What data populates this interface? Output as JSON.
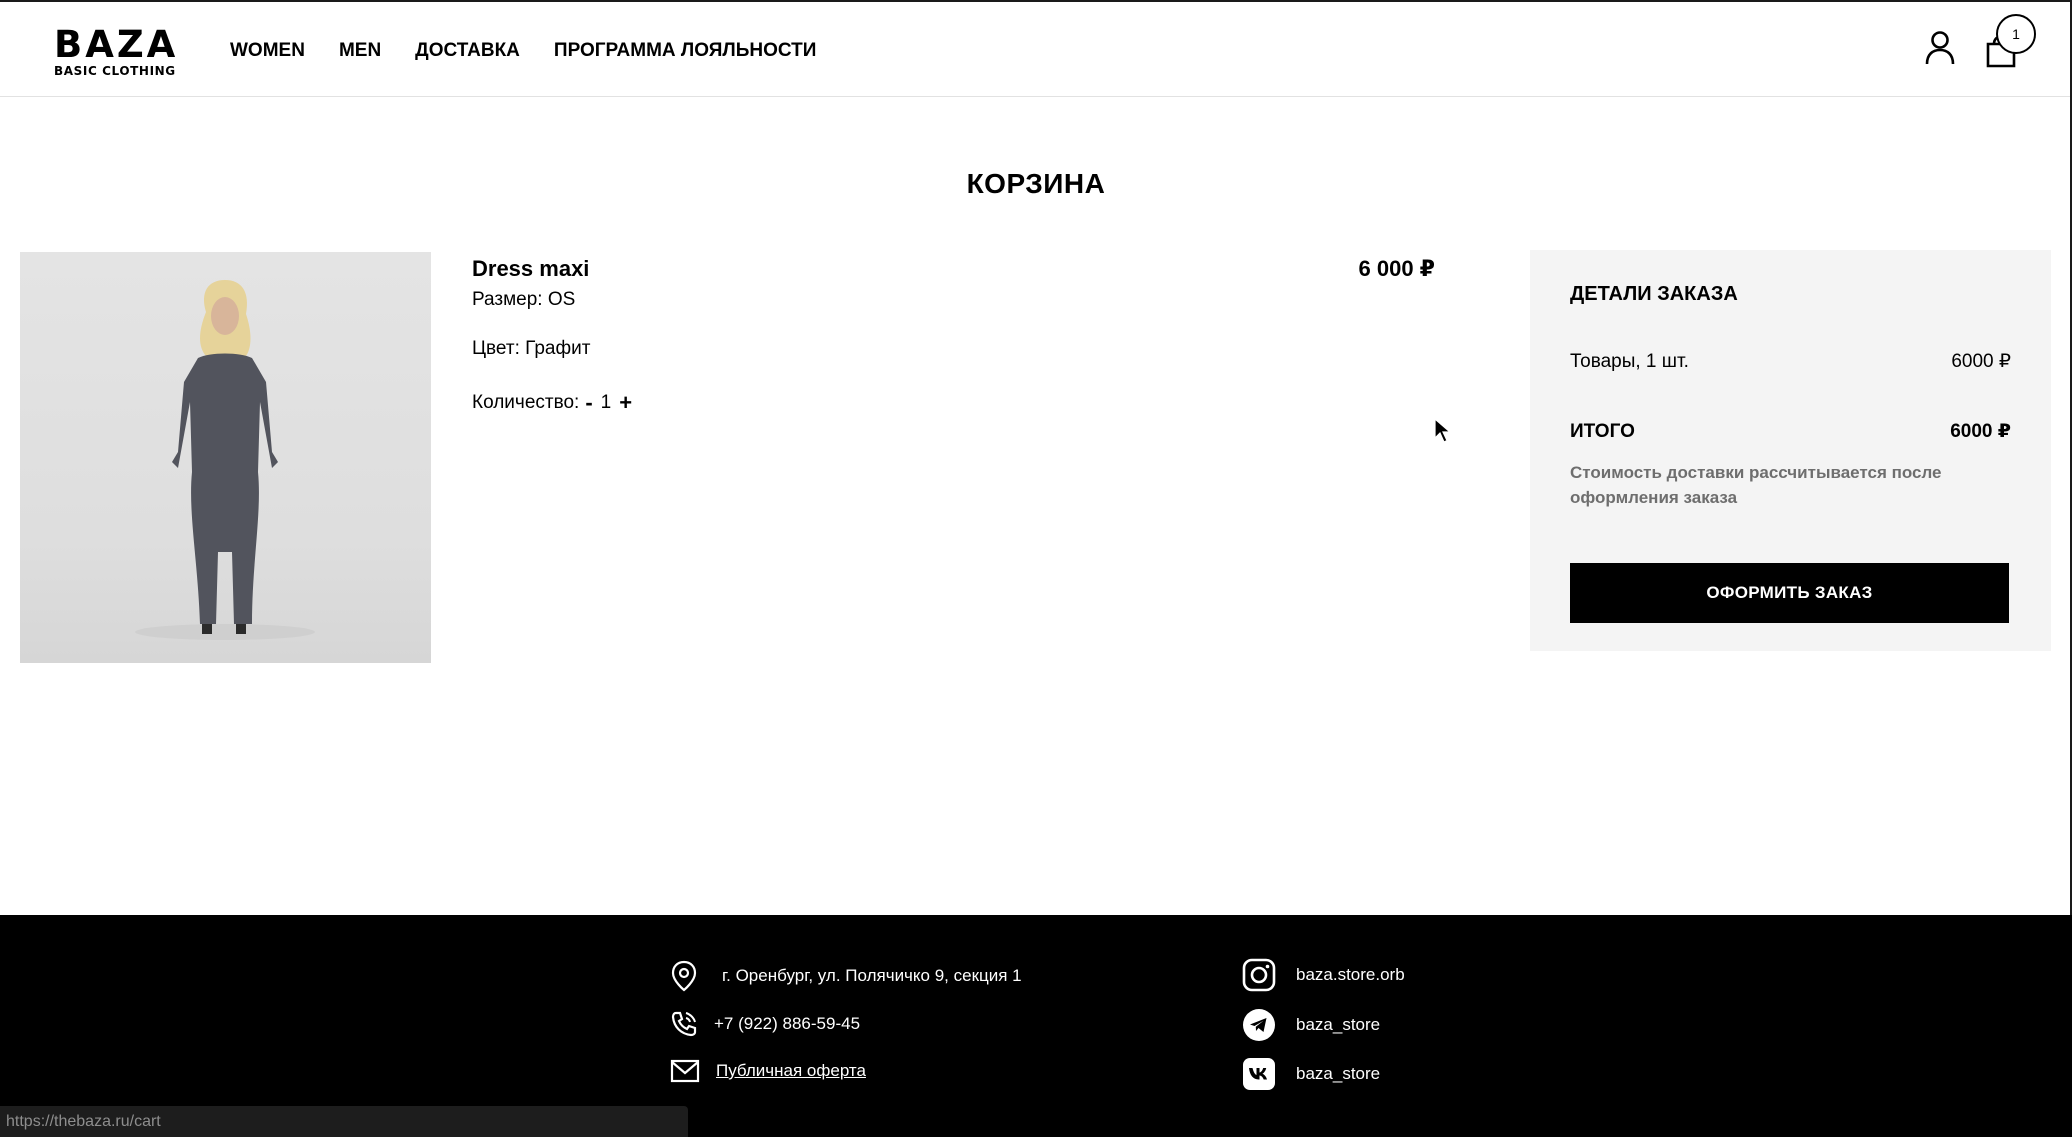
{
  "brand": {
    "name": "BAZA",
    "tagline": "BASIC CLOTHING"
  },
  "nav": {
    "items": [
      {
        "label": "WOMEN"
      },
      {
        "label": "MEN"
      },
      {
        "label": "ДОСТАВКА"
      },
      {
        "label": "ПРОГРАММА ЛОЯЛЬНОСТИ"
      }
    ]
  },
  "header": {
    "cart_count": "1"
  },
  "page": {
    "title": "КОРЗИНА"
  },
  "cart_item": {
    "name": "Dress maxi",
    "price": "6 000 ₽",
    "size": "Размер: OS",
    "color": "Цвет: Графит",
    "quantity_label": "Количество:",
    "decrement": "-",
    "quantity": "1",
    "increment": "+"
  },
  "summary": {
    "title": "ДЕТАЛИ ЗАКАЗА",
    "goods_label": "Товары, 1 шт.",
    "goods_value": "6000 ₽",
    "total_label": "ИТОГО",
    "total_value": "6000 ₽",
    "note": "Стоимость доставки рассчитывается после оформления заказа",
    "checkout_label": "ОФОРМИТЬ ЗАКАЗ"
  },
  "footer": {
    "address": "г. Оренбург, ул. Полячичко 9, секция 1",
    "phone": "+7 (922) 886-59-45",
    "offer_link": "Публичная оферта",
    "instagram": "baza.store.orb",
    "telegram": "baza_store",
    "vk": "baza_store"
  },
  "status_bar": {
    "url": "https://thebaza.ru/cart"
  },
  "colors": {
    "accent": "#000000",
    "summary_bg": "#f4f4f4",
    "note_text": "#6e6e6e",
    "dress": "#52545d"
  },
  "icons": [
    "user-icon",
    "cart-icon",
    "location-icon",
    "phone-icon",
    "mail-icon",
    "instagram-icon",
    "telegram-icon",
    "vk-icon"
  ]
}
